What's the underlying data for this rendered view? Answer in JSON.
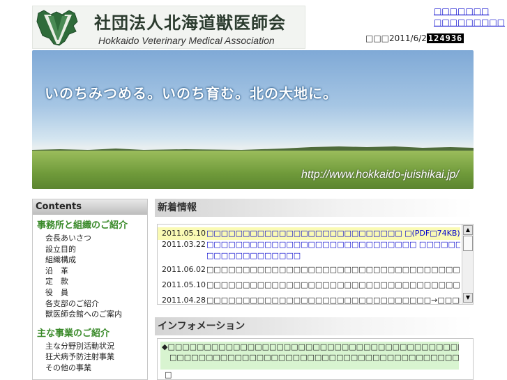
{
  "header": {
    "logo_jp": "社団法人北海道獣医師会",
    "logo_en": "Hokkaido Veterinary Medical Association",
    "links": [
      "□□□□□□□",
      "□□□□□□□□□"
    ],
    "counter_label": "□□□2011/6/2",
    "counter_value": "124936"
  },
  "banner": {
    "slogan": "いのちみつめる。いのち育む。北の大地に。",
    "url": "http://www.hokkaido-juishikai.jp/"
  },
  "sidebar": {
    "heading": "Contents",
    "sections": [
      {
        "title": "事務所と組織のご紹介",
        "items": [
          "会長あいさつ",
          "設立目的",
          "組織構成",
          "沿　革",
          "定　款",
          "役　員",
          "各支部のご紹介",
          "獣医師会館へのご案内"
        ]
      },
      {
        "title": "主な事業のご紹介",
        "items": [
          "主な分野別活動状況",
          "狂犬病予防注射事業",
          "その他の事業"
        ]
      }
    ]
  },
  "news": {
    "heading": "新着情報",
    "rows": [
      {
        "date": "2011.05.10",
        "text": "□□□□□□□□□□□□□□□□□□□□□□□□□□□ □(PDF□74KB)",
        "highlight": true,
        "link": true
      },
      {
        "date": "2011.03.22",
        "text": "□□□□□□□□□□□□□□□□□□□□□□□□□□□□□ □□□□□□□□□□□□□□□□□□□□",
        "highlight": false,
        "link": true
      },
      {
        "date": "",
        "text": "□□□□□□□□□□□□□",
        "highlight": false,
        "link": true
      },
      {
        "date": "2011.06.02",
        "text": "□□□□□□□□□□□□□□□□□□□□□□□□□□□□□□□□□□□□□□□□□□□□□",
        "highlight": false,
        "link": false
      },
      {
        "date": "2011.05.10",
        "text": "□□□□□□□□□□□□□□□□□□□□□□□□□□□□□□□□□□□□□□□□□□□□□□□□□□□",
        "highlight": false,
        "link": false
      },
      {
        "date": "2011.04.28",
        "text": "□□□□□□□□□□□□□□□□□□□□□□□□□□□□□□□→□□□□□□□□□□□□□□□□□□□",
        "highlight": false,
        "link": false
      }
    ]
  },
  "info": {
    "heading": "インフォメーション",
    "lines": [
      "◆□□□□□□□□□□□□□□□□□□□□□□□□□□□□□□□□□□□□□□□□□",
      "　□□□□□□□□□□□□□□□□□□□□□□□□□□□□□□□□□□□□□□□□□□□□□□□□□□□"
    ],
    "extra": "□"
  },
  "colors": {
    "accent_green": "#3a8a2a",
    "highlight_yellow": "#fafab4",
    "info_green": "#d8f4d0"
  }
}
